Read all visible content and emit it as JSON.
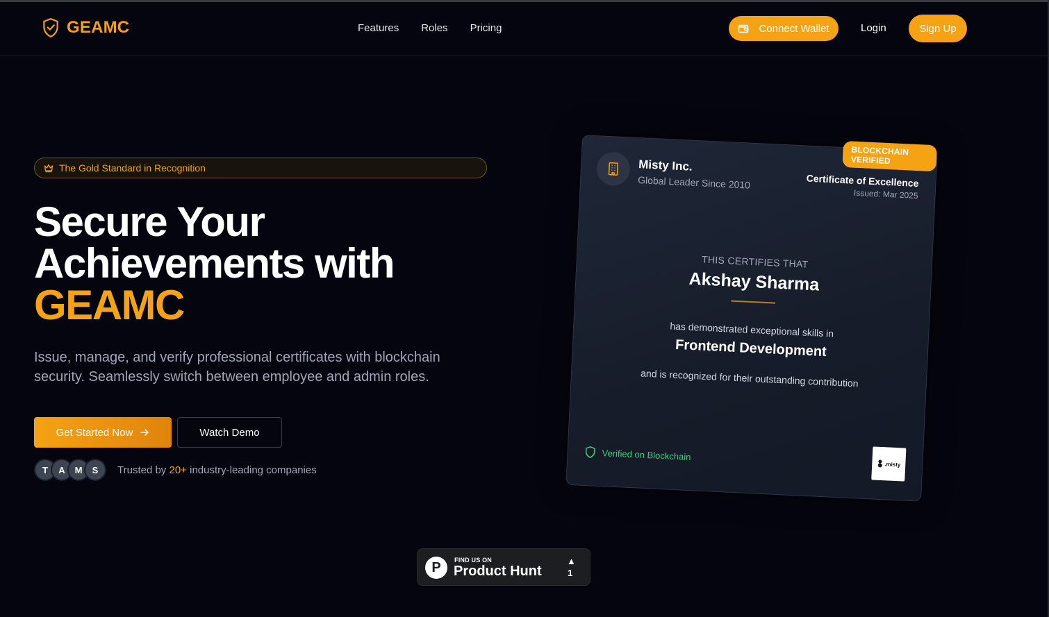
{
  "header": {
    "logo_text": "GEAMC",
    "nav": [
      "Features",
      "Roles",
      "Pricing"
    ],
    "connect_wallet": "Connect Wallet",
    "login": "Login",
    "signup": "Sign Up"
  },
  "hero": {
    "badge": "The Gold Standard in Recognition",
    "title_line1": "Secure Your",
    "title_line2": "Achievements with",
    "title_accent": "GEAMC",
    "description": "Issue, manage, and verify professional certificates with blockchain security. Seamlessly switch between employee and admin roles.",
    "cta_primary": "Get Started Now",
    "cta_secondary": "Watch Demo",
    "avatars": [
      "T",
      "A",
      "M",
      "S"
    ],
    "trusted_prefix": "Trusted by ",
    "trusted_count": "20+",
    "trusted_suffix": " industry-leading companies"
  },
  "certificate": {
    "badge": "BLOCKCHAIN VERIFIED",
    "company": "Misty Inc.",
    "company_sub": "Global Leader Since 2010",
    "type": "Certificate of Excellence",
    "issued": "Issued: Mar 2025",
    "certifies": "THIS CERTIFIES THAT",
    "recipient": "Akshay Sharma",
    "demonstrated": "has demonstrated exceptional skills in",
    "skill": "Frontend Development",
    "contribution": "and is recognized for their outstanding contribution",
    "verified": "Verified on Blockchain",
    "logo_text": ".misty"
  },
  "product_hunt": {
    "find_us": "FIND US ON",
    "name": "Product Hunt",
    "votes": "1"
  },
  "colors": {
    "accent": "#f5a214",
    "background": "#04050f",
    "verified": "#3ad17a"
  }
}
